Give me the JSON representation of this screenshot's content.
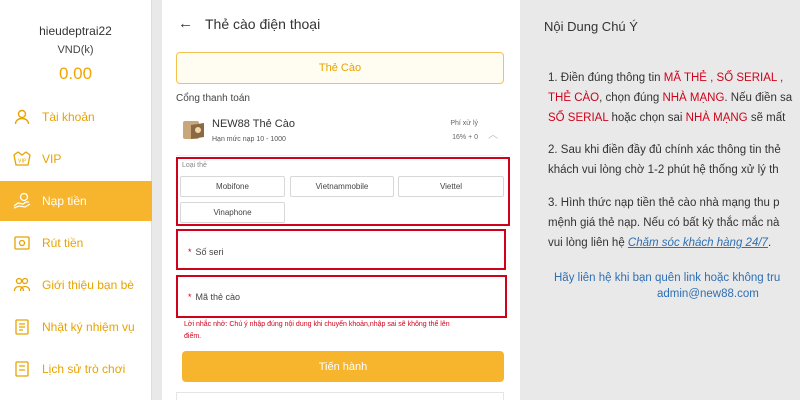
{
  "user": {
    "username": "hieudeptrai22",
    "currency": "VND(k)",
    "balance": "0.00"
  },
  "sidebar": {
    "items": [
      {
        "label": "Tài khoản",
        "icon": "user-icon"
      },
      {
        "label": "VIP",
        "icon": "vip-icon"
      },
      {
        "label": "Nạp tiền",
        "icon": "deposit-icon",
        "active": true
      },
      {
        "label": "Rút tiền",
        "icon": "withdraw-icon"
      },
      {
        "label": "Giới thiệu bạn bè",
        "icon": "referral-icon"
      },
      {
        "label": "Nhật ký nhiệm vụ",
        "icon": "task-log-icon"
      },
      {
        "label": "Lịch sử trò chơi",
        "icon": "game-history-icon"
      }
    ]
  },
  "main": {
    "title": "Thẻ cào điện thoại",
    "tab_label": "Thẻ Cào",
    "gateway_section_label": "Cổng thanh toán",
    "gateway": {
      "name": "NEW88 Thẻ Cào",
      "limit": "Hạn mức nạp 10 - 1000",
      "fee_label": "Phí xử lý",
      "fee_value": "16% + 0"
    },
    "card_type_label": "Loại thẻ",
    "card_types": [
      "Mobifone",
      "Vietnammobile",
      "Viettel",
      "Vinaphone"
    ],
    "serial_label": "Số seri",
    "card_code_label": "Mã thẻ cào",
    "required_mark": "*",
    "note_line1": "Lời nhắc nhở: Chú ý nhập đúng nội dung khi chuyển khoản,nhập sai sẽ không thể lên",
    "note_line2": "điểm.",
    "submit_label": "Tiến hành"
  },
  "notes": {
    "title": "Nội Dung Chú Ý",
    "p1": {
      "prefix": "1. Điền đúng thông tin ",
      "red1": "MÃ THẺ , SỐ SERIAL ,",
      "line2_red1": "THẺ CÀO",
      "line2_mid": ", chọn đúng ",
      "line2_red2": "NHÀ MẠNG",
      "line2_suffix": ". Nếu điền sa",
      "line3_red1": "SỐ SERIAL",
      "line3_mid": " hoặc chọn sai ",
      "line3_red2": "NHÀ MẠNG",
      "line3_suffix": " sẽ mất"
    },
    "p2": {
      "line1": "2. Sau khi điền đầy đủ chính xác thông tin thẻ",
      "line2": "khách vui lòng chờ 1-2 phút hệ thống xử lý th"
    },
    "p3": {
      "line1": "3. Hình thức nạp tiền thẻ cào nhà mạng thu p",
      "line2": "mệnh giá thẻ nạp. Nếu có bất kỳ thắc mắc nà",
      "line3_prefix": "vui lòng liên hệ ",
      "line3_link": "Chăm sóc khách hàng 24/7",
      "line3_suffix": "."
    },
    "contact": "Hãy liên hệ khi bạn quên link hoặc không tru",
    "email": "admin@new88.com"
  },
  "colors": {
    "accent": "#f7b52e",
    "highlight": "#d0021b",
    "link": "#2f6fb3"
  }
}
